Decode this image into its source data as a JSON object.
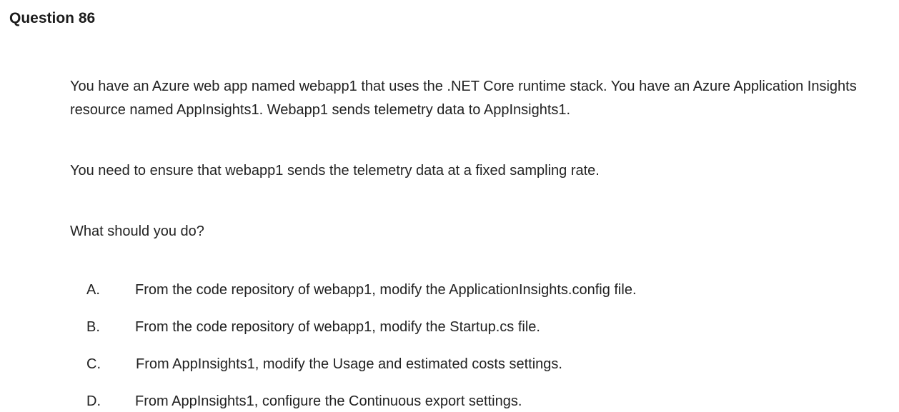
{
  "question": {
    "title": "Question 86",
    "paragraphs": [
      "You have an Azure web app named webapp1 that uses the .NET Core runtime stack. You have an Azure Application Insights resource named AppInsights1. Webapp1 sends telemetry data to AppInsights1.",
      "You need to ensure that webapp1 sends the telemetry data at a fixed sampling rate.",
      "What should you do?"
    ],
    "options": [
      {
        "letter": "A.",
        "text": "From the code repository of webapp1, modify the ApplicationInsights.config file."
      },
      {
        "letter": "B.",
        "text": "From the code repository of webapp1, modify the Startup.cs file."
      },
      {
        "letter": "C.",
        "text": "From AppInsights1, modify the Usage and estimated costs settings."
      },
      {
        "letter": "D.",
        "text": "From AppInsights1, configure the Continuous export settings."
      }
    ]
  }
}
